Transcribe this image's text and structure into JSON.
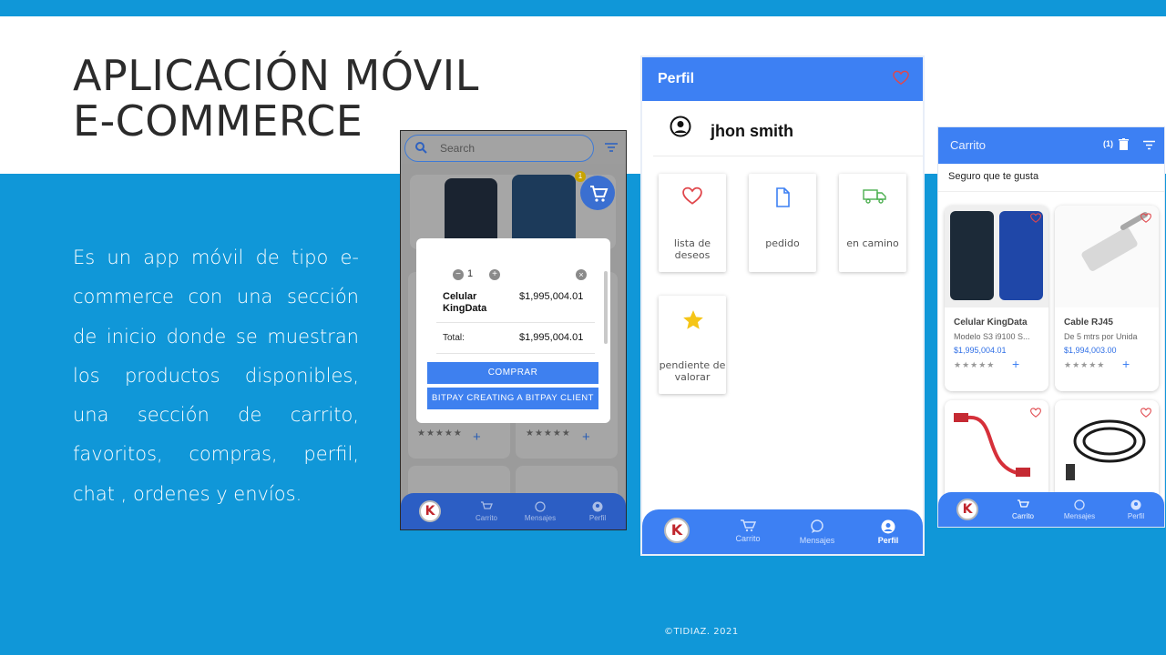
{
  "slide": {
    "title_line1": "APLICACIÓN MÓVIL",
    "title_line2": "E-COMMERCE",
    "description": "Es un app móvil de tipo e-commerce con una sección de inicio donde se muestran los productos disponibles, una sección de carrito, favoritos, compras, perfil, chat , ordenes  y envíos.",
    "footer": "©TIDIAZ. 2021"
  },
  "phone_home": {
    "search_placeholder": "Search",
    "cart_badge": "1",
    "modal": {
      "qty": "1",
      "product_name": "Celular KingData",
      "product_price": "$1,995,004.01",
      "total_label": "Total:",
      "total_value": "$1,995,004.01",
      "buy_button": "COMPRAR",
      "bitpay_button": "BITPAY CREATING A BITPAY CLIENT"
    },
    "stars": "★★★★★",
    "nav": {
      "cart": "Carrito",
      "messages": "Mensajes",
      "profile": "Perfil",
      "logo": "K"
    }
  },
  "phone_profile": {
    "header_title": "Perfil",
    "user_name": "jhon smith",
    "tiles": {
      "wishlist": "lista de deseos",
      "order": "pedido",
      "shipping": "en camino",
      "pending_review": "pendiente de valorar"
    },
    "nav": {
      "cart": "Carrito",
      "messages": "Mensajes",
      "profile": "Perfil",
      "logo": "K"
    }
  },
  "phone_cart": {
    "header_title": "Carrito",
    "cart_count": "(1)",
    "subtitle": "Seguro que te gusta",
    "products": [
      {
        "name": "Celular KingData",
        "desc": "Modelo S3 i9100 S...",
        "price": "$1,995,004.01",
        "stars": "★★★★★"
      },
      {
        "name": "Cable RJ45",
        "desc": "De 5 mtrs por Unida",
        "price": "$1,994,003.00",
        "stars": "★★★★★"
      }
    ],
    "nav": {
      "cart": "Carrito",
      "messages": "Mensajes",
      "profile": "Perfil",
      "logo": "K"
    }
  },
  "colors": {
    "slide_blue": "#1097d8",
    "app_blue": "#3d80f3",
    "heart_red": "#e0474c",
    "star_gold": "#f5c518",
    "truck_green": "#4caf50"
  }
}
